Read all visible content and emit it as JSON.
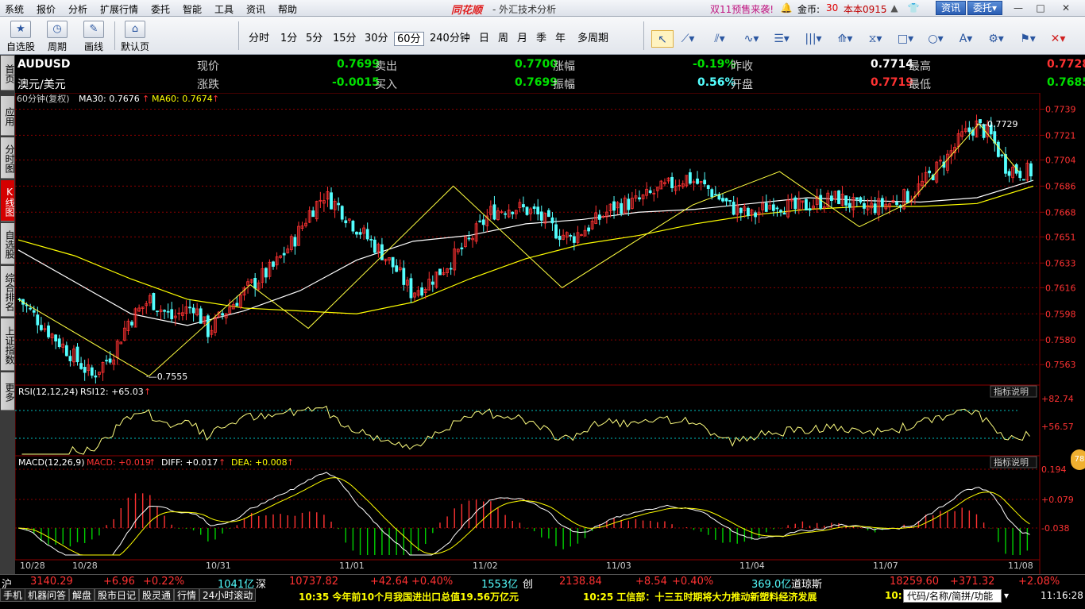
{
  "menu": {
    "items": [
      "系统",
      "报价",
      "分析",
      "扩展行情",
      "委托",
      "智能",
      "工具",
      "资讯",
      "帮助"
    ],
    "brand": "同花顺",
    "window_title": "- 外汇技术分析",
    "promo": "双11预售来袭!",
    "coins_label": "金币:",
    "coins_value": "30",
    "user": "本本0915",
    "news_button": "资讯",
    "trade_button": "委托▾"
  },
  "toolbar": {
    "big_buttons": [
      {
        "label": "自选股",
        "icon": "star-icon"
      },
      {
        "label": "周期",
        "icon": "clock-icon"
      },
      {
        "label": "画线",
        "icon": "pen-icon"
      },
      {
        "label": "默认页",
        "icon": "home-icon"
      }
    ],
    "periods": [
      "分时",
      "1分",
      "5分",
      "15分",
      "30分",
      "60分",
      "240分钟",
      "日",
      "周",
      "月",
      "季",
      "年",
      "多周期"
    ],
    "active_period": "60分"
  },
  "sidebar": {
    "tabs": [
      "首页",
      "应用",
      "分时图",
      "K线图",
      "自选股",
      "综合排名",
      "上证指数",
      "更多"
    ],
    "active_tab": "K线图"
  },
  "quote": {
    "symbol": "AUDUSD",
    "name": "澳元/美元",
    "fields": [
      {
        "label": "现价",
        "value": "0.7699"
      },
      {
        "label": "卖出",
        "value": "0.7700"
      },
      {
        "label": "涨幅",
        "value": "-0.19%"
      },
      {
        "label": "昨收",
        "value": "0.7714"
      },
      {
        "label": "最高",
        "value": "0.7728"
      },
      {
        "label": "涨跌",
        "value": "-0.0015"
      },
      {
        "label": "买入",
        "value": "0.7699"
      },
      {
        "label": "振幅",
        "value": "0.56%"
      },
      {
        "label": "开盘",
        "value": "0.7719"
      },
      {
        "label": "最低",
        "value": "0.7685"
      }
    ]
  },
  "indicators": {
    "main_label": "60分钟(复权)",
    "ma30": "MA30: 0.7676",
    "ma60": "MA60: 0.7674",
    "rsi_label": "RSI(12,12,24)",
    "rsi_value": "RSI12: +65.03",
    "macd_label": "MACD(12,26,9)",
    "macd_value": "MACD: +0.019",
    "diff_value": "DIFF: +0.017",
    "dea_value": "DEA: +0.008",
    "explain_button": "指标说明",
    "high_mark": "0.7729",
    "low_mark": "0.7555"
  },
  "chart_data": {
    "type": "candlestick",
    "ylim": [
      0.755,
      0.7742
    ],
    "y_ticks": [
      "0.7739",
      "0.7721",
      "0.7704",
      "0.7686",
      "0.7668",
      "0.7651",
      "0.7633",
      "0.7616",
      "0.7598",
      "0.7580",
      "0.7563"
    ],
    "x_labels": [
      "10/28",
      "10/28",
      "10/31",
      "11/01",
      "11/02",
      "11/03",
      "11/04",
      "11/07",
      "11/08"
    ],
    "rsi_ticks": [
      "+82.74",
      "+56.57"
    ],
    "macd_ticks": [
      "0.194",
      "+0.079",
      "-0.038"
    ],
    "price_path": [
      [
        0,
        0.7608
      ],
      [
        8,
        0.7586
      ],
      [
        14,
        0.7571
      ],
      [
        20,
        0.7555
      ],
      [
        26,
        0.7572
      ],
      [
        30,
        0.7593
      ],
      [
        36,
        0.7608
      ],
      [
        42,
        0.7595
      ],
      [
        48,
        0.7604
      ],
      [
        52,
        0.7586
      ],
      [
        58,
        0.7603
      ],
      [
        64,
        0.7618
      ],
      [
        70,
        0.763
      ],
      [
        76,
        0.765
      ],
      [
        80,
        0.7668
      ],
      [
        84,
        0.768
      ],
      [
        88,
        0.7672
      ],
      [
        92,
        0.766
      ],
      [
        96,
        0.765
      ],
      [
        100,
        0.764
      ],
      [
        104,
        0.7628
      ],
      [
        108,
        0.7613
      ],
      [
        112,
        0.7618
      ],
      [
        118,
        0.7632
      ],
      [
        124,
        0.7648
      ],
      [
        130,
        0.7668
      ],
      [
        136,
        0.7672
      ],
      [
        142,
        0.7668
      ],
      [
        148,
        0.7655
      ],
      [
        152,
        0.765
      ],
      [
        158,
        0.766
      ],
      [
        164,
        0.7672
      ],
      [
        170,
        0.7675
      ],
      [
        178,
        0.7685
      ],
      [
        184,
        0.7692
      ],
      [
        190,
        0.7684
      ],
      [
        196,
        0.7672
      ],
      [
        202,
        0.7665
      ],
      [
        208,
        0.7675
      ],
      [
        214,
        0.767
      ],
      [
        220,
        0.7675
      ],
      [
        226,
        0.7678
      ],
      [
        232,
        0.767
      ],
      [
        240,
        0.7674
      ],
      [
        246,
        0.768
      ],
      [
        250,
        0.769
      ],
      [
        256,
        0.7706
      ],
      [
        260,
        0.772
      ],
      [
        264,
        0.7728
      ],
      [
        268,
        0.772
      ],
      [
        272,
        0.77
      ],
      [
        276,
        0.7696
      ]
    ],
    "ma30": [
      0.7642,
      0.762,
      0.7598,
      0.759,
      0.76,
      0.7614,
      0.7635,
      0.7648,
      0.7652,
      0.766,
      0.7663,
      0.7668,
      0.767,
      0.7674,
      0.7678,
      0.7676,
      0.7675,
      0.7678,
      0.769
    ],
    "ma60": [
      0.7649,
      0.7638,
      0.7622,
      0.7608,
      0.7602,
      0.76,
      0.7598,
      0.7606,
      0.7622,
      0.7636,
      0.7646,
      0.7652,
      0.766,
      0.7666,
      0.767,
      0.7672,
      0.7672,
      0.7674,
      0.7686
    ],
    "zigzag": [
      [
        0,
        0.7608
      ],
      [
        36,
        0.7555
      ],
      [
        64,
        0.7618
      ],
      [
        80,
        0.7588
      ],
      [
        120,
        0.7686
      ],
      [
        150,
        0.7616
      ],
      [
        186,
        0.7673
      ],
      [
        210,
        0.7696
      ],
      [
        232,
        0.7658
      ],
      [
        246,
        0.7675
      ],
      [
        265,
        0.7729
      ],
      [
        276,
        0.7696
      ]
    ],
    "total_bars": 280
  },
  "ticker": {
    "sh_label": "沪",
    "sh_value": "3140.29",
    "sh_change": "+6.96",
    "sh_pct": "+0.22%",
    "sh_amount": "1041亿",
    "sz_label": "深",
    "sz_value": "10737.82",
    "sz_change": "+42.64",
    "sz_pct": "+0.40%",
    "sz_amount": "1553亿",
    "cy_label": "创",
    "cy_value": "2138.84",
    "cy_change": "+8.54",
    "cy_pct": "+0.40%",
    "cy_amount": "369.0亿",
    "dj_label": "道琼斯",
    "dj_value": "18259.60",
    "dj_change": "+371.32",
    "dj_pct": "+2.08%"
  },
  "bottom": {
    "tabs": [
      "手机",
      "机器问答",
      "解盘",
      "股市日记",
      "股灵通",
      "行情",
      "24小时滚动"
    ],
    "news1": "10:35 今年前10个月我国进出口总值19.56万亿元",
    "news2": "10:25 工信部：十三五时期将大力推动新塑料经济发展",
    "news3": "10:",
    "search_placeholder": "代码/名称/简拼/功能",
    "time": "11:16:28",
    "badge": "78"
  },
  "colors": {
    "up": "#ff3232",
    "down": "#54ffff",
    "ma30": "#ffffff",
    "ma60": "#ffff00",
    "grid": "#8b0000",
    "text_green": "#00e000"
  }
}
